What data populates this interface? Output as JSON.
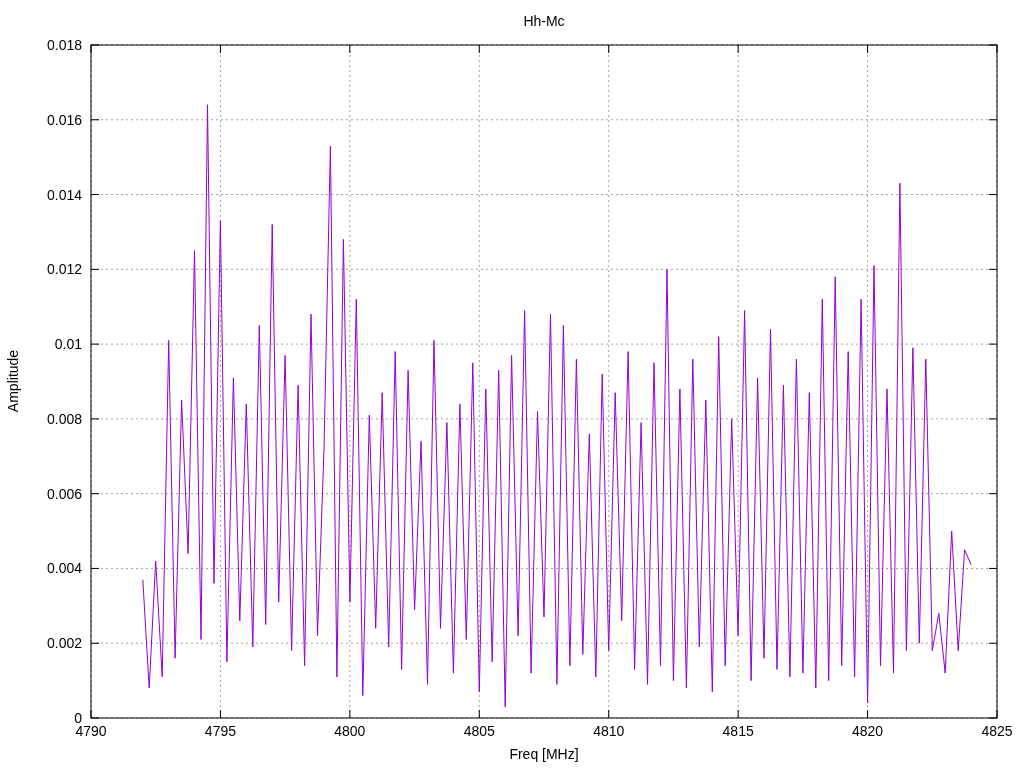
{
  "chart_data": {
    "type": "line",
    "title": "Hh-Mc",
    "xlabel": "Freq [MHz]",
    "ylabel": "Amplitude",
    "grid": true,
    "xlim": [
      4790,
      4825
    ],
    "ylim": [
      0,
      0.018
    ],
    "xticks": [
      {
        "value": 4790,
        "label": "4790"
      },
      {
        "value": 4795,
        "label": "4795"
      },
      {
        "value": 4800,
        "label": "4800"
      },
      {
        "value": 4805,
        "label": "4805"
      },
      {
        "value": 4810,
        "label": "4810"
      },
      {
        "value": 4815,
        "label": "4815"
      },
      {
        "value": 4820,
        "label": "4820"
      },
      {
        "value": 4825,
        "label": "4825"
      }
    ],
    "yticks": [
      {
        "value": 0,
        "label": "0"
      },
      {
        "value": 0.002,
        "label": "0.002"
      },
      {
        "value": 0.004,
        "label": "0.004"
      },
      {
        "value": 0.006,
        "label": "0.006"
      },
      {
        "value": 0.008,
        "label": "0.008"
      },
      {
        "value": 0.01,
        "label": "0.01"
      },
      {
        "value": 0.012,
        "label": "0.012"
      },
      {
        "value": 0.014,
        "label": "0.014"
      },
      {
        "value": 0.016,
        "label": "0.016"
      },
      {
        "value": 0.018,
        "label": "0.018"
      }
    ],
    "x": [
      4792,
      4792.25,
      4792.5,
      4792.75,
      4793,
      4793.25,
      4793.5,
      4793.75,
      4794,
      4794.25,
      4794.5,
      4794.75,
      4795,
      4795.25,
      4795.5,
      4795.75,
      4796,
      4796.25,
      4796.5,
      4796.75,
      4797,
      4797.25,
      4797.5,
      4797.75,
      4798,
      4798.25,
      4798.5,
      4798.75,
      4799,
      4799.25,
      4799.5,
      4799.75,
      4800,
      4800.25,
      4800.5,
      4800.75,
      4801,
      4801.25,
      4801.5,
      4801.75,
      4802,
      4802.25,
      4802.5,
      4802.75,
      4803,
      4803.25,
      4803.5,
      4803.75,
      4804,
      4804.25,
      4804.5,
      4804.75,
      4805,
      4805.25,
      4805.5,
      4805.75,
      4806,
      4806.25,
      4806.5,
      4806.75,
      4807,
      4807.25,
      4807.5,
      4807.75,
      4808,
      4808.25,
      4808.5,
      4808.75,
      4809,
      4809.25,
      4809.5,
      4809.75,
      4810,
      4810.25,
      4810.5,
      4810.75,
      4811,
      4811.25,
      4811.5,
      4811.75,
      4812,
      4812.25,
      4812.5,
      4812.75,
      4813,
      4813.25,
      4813.5,
      4813.75,
      4814,
      4814.25,
      4814.5,
      4814.75,
      4815,
      4815.25,
      4815.5,
      4815.75,
      4816,
      4816.25,
      4816.5,
      4816.75,
      4817,
      4817.25,
      4817.5,
      4817.75,
      4818,
      4818.25,
      4818.5,
      4818.75,
      4819,
      4819.25,
      4819.5,
      4819.75,
      4820,
      4820.25,
      4820.5,
      4820.75,
      4821,
      4821.25,
      4821.5,
      4821.75,
      4822,
      4822.25,
      4822.5,
      4822.75,
      4823,
      4823.25,
      4823.5,
      4823.75,
      4824
    ],
    "series": [
      {
        "color": "#9400d3",
        "values": [
          0.0037,
          0.0008,
          0.0042,
          0.0011,
          0.0101,
          0.0016,
          0.0085,
          0.0044,
          0.0125,
          0.0021,
          0.0164,
          0.0036,
          0.0133,
          0.0015,
          0.0091,
          0.0026,
          0.0084,
          0.0019,
          0.0105,
          0.0025,
          0.0132,
          0.0031,
          0.0097,
          0.0018,
          0.0089,
          0.0014,
          0.0108,
          0.0022,
          0.0072,
          0.0153,
          0.0011,
          0.0128,
          0.0031,
          0.0112,
          0.0006,
          0.0081,
          0.0024,
          0.0087,
          0.0019,
          0.0098,
          0.0013,
          0.0093,
          0.0029,
          0.0074,
          0.0009,
          0.0101,
          0.0024,
          0.0079,
          0.0012,
          0.0084,
          0.0021,
          0.0095,
          0.0007,
          0.0088,
          0.0015,
          0.0093,
          0.0003,
          0.0097,
          0.0022,
          0.0109,
          0.0012,
          0.0082,
          0.0027,
          0.0108,
          0.0009,
          0.0105,
          0.0014,
          0.0096,
          0.0017,
          0.0076,
          0.0011,
          0.0092,
          0.0018,
          0.0087,
          0.0026,
          0.0098,
          0.0013,
          0.0079,
          0.0009,
          0.0095,
          0.0014,
          0.012,
          0.001,
          0.0088,
          0.0008,
          0.0096,
          0.0019,
          0.0085,
          0.0007,
          0.0102,
          0.0014,
          0.008,
          0.0022,
          0.0109,
          0.001,
          0.0091,
          0.0016,
          0.0104,
          0.0013,
          0.0089,
          0.0011,
          0.0096,
          0.0012,
          0.0087,
          0.0008,
          0.0112,
          0.001,
          0.0118,
          0.0014,
          0.0098,
          0.0011,
          0.0112,
          0.0004,
          0.0121,
          0.0014,
          0.0088,
          0.0012,
          0.0143,
          0.0018,
          0.0099,
          0.002,
          0.0096,
          0.0018,
          0.0028,
          0.0012,
          0.005,
          0.0018,
          0.0045,
          0.0041
        ]
      }
    ]
  }
}
